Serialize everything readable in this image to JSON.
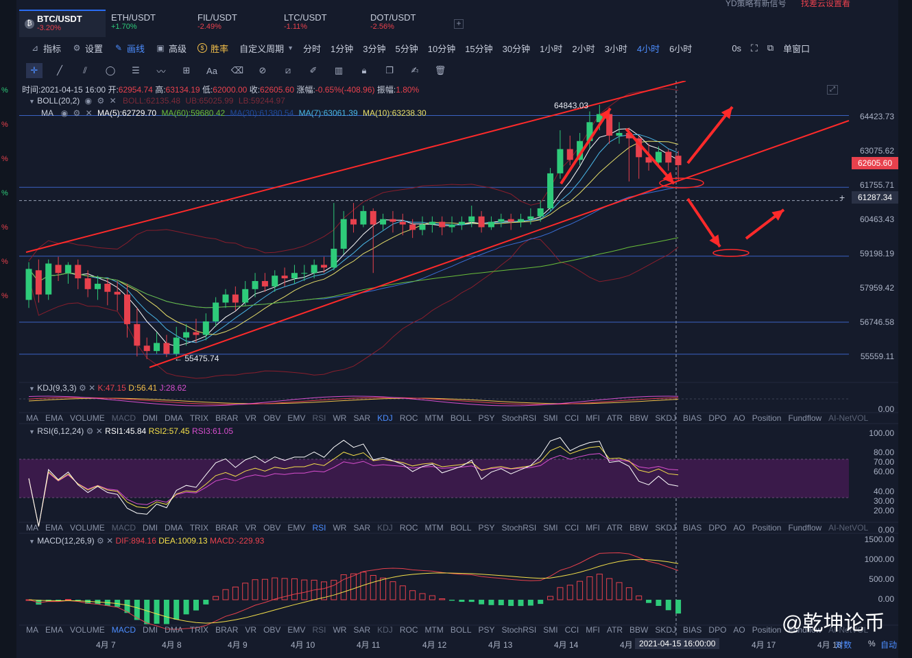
{
  "top_notice": {
    "left": "YD策略有新信号",
    "right": "找差云设置看"
  },
  "tabs": [
    {
      "symbol": "BTC/USDT",
      "change": "-3.20%",
      "dir": "neg",
      "icon": "btc-coin-icon"
    },
    {
      "symbol": "ETH/USDT",
      "change": "+1.70%",
      "dir": "pos"
    },
    {
      "symbol": "FIL/USDT",
      "change": "-2.49%",
      "dir": "neg"
    },
    {
      "symbol": "LTC/USDT",
      "change": "-1.11%",
      "dir": "neg"
    },
    {
      "symbol": "DOT/USDT",
      "change": "-2.56%",
      "dir": "neg"
    }
  ],
  "tab_add": "+",
  "toolbar": {
    "indicators": "指标",
    "settings": "设置",
    "draw": "画线",
    "advanced": "高级",
    "winrate": "胜率",
    "custom_period": "自定义周期",
    "periods": [
      "分时",
      "1分钟",
      "3分钟",
      "5分钟",
      "10分钟",
      "15分钟",
      "30分钟",
      "1小时",
      "2小时",
      "3小时",
      "4小时",
      "6小时"
    ],
    "active_period": "4小时",
    "countdown": "0s",
    "single_window": "单窗口"
  },
  "drawing_tools": [
    "crosshair-icon",
    "line-icon",
    "ray-icon",
    "circle-icon",
    "parallel-icon",
    "wave-icon",
    "rect-icon",
    "text-icon",
    "eraser-icon",
    "magnet-icon",
    "ruler-icon",
    "brush-icon",
    "bars-icon",
    "lock-icon",
    "copy-icon",
    "edit-icon",
    "trash-icon"
  ],
  "text_tool_label": "Aa",
  "ohlc_bar": {
    "time_label": "时间:",
    "time": "2021-04-15 16:00",
    "open_label": "开:",
    "open": "62954.74",
    "high_label": "高:",
    "high": "63134.19",
    "low_label": "低:",
    "low": "62000.00",
    "close_label": "收:",
    "close": "62605.60",
    "change_label": "涨幅:",
    "change": "-0.65%(-408.96)",
    "amp_label": "振幅:",
    "amp": "1.80%"
  },
  "boll_legend": {
    "name": "BOLL(20,2)",
    "boll": "BOLL:62135.48",
    "ub": "UB:65025.99",
    "lb": "LB:59244.97"
  },
  "ma_legend": {
    "name": "MA",
    "ma5": "MA(5):62729.70",
    "ma60": "MA(60):59680.42",
    "ma30": "MA(30):61380.54",
    "ma7": "MA(7):63061.39",
    "ma10": "MA(10):63238.30"
  },
  "price_axis": [
    "64423.73",
    "63075.62",
    "61755.71",
    "60463.43",
    "59198.19",
    "57959.42",
    "56746.58",
    "55559.11"
  ],
  "current_price": "62605.60",
  "cursor_price": "61287.34",
  "cursor_plus": "+",
  "high_marker": "64843.03",
  "low_marker": "55475.74",
  "kdj_legend": {
    "name": "KDJ(9,3,3)",
    "k": "K:47.15",
    "d": "D:56.41",
    "j": "J:28.62",
    "axis": "0.00"
  },
  "indicator_tabs": [
    "MA",
    "EMA",
    "VOLUME",
    "MACD",
    "DMI",
    "DMA",
    "TRIX",
    "BRAR",
    "VR",
    "OBV",
    "EMV",
    "RSI",
    "WR",
    "SAR",
    "KDJ",
    "ROC",
    "MTM",
    "BOLL",
    "PSY",
    "StochRSI",
    "SMI",
    "CCI",
    "MFI",
    "ATR",
    "BBW",
    "SKDJ",
    "BIAS",
    "DPO",
    "AO",
    "Position",
    "Fundflow",
    "AI-NetVOL"
  ],
  "rsi_legend": {
    "name": "RSI(6,12,24)",
    "r1": "RSI1:45.84",
    "r2": "RSI2:57.45",
    "r3": "RSI3:61.05",
    "axis": [
      "100.00",
      "80.00",
      "70.00",
      "60.00",
      "40.00",
      "30.00",
      "20.00",
      "0.00"
    ]
  },
  "macd_legend": {
    "name": "MACD(12,26,9)",
    "dif": "DIF:894.16",
    "dea": "DEA:1009.13",
    "macd": "MACD:-229.93",
    "axis": [
      "1500.00",
      "1000.00",
      "500.00",
      "0.00"
    ]
  },
  "dates": [
    "4月 7",
    "4月 8",
    "4月 9",
    "4月 10",
    "4月 11",
    "4月 12",
    "4月 13",
    "4月 14",
    "4月",
    "4月 17",
    "4月 18"
  ],
  "cursor_date": "2021-04-15 16:00:00",
  "axis_options": {
    "log": "对数",
    "pct": "%",
    "auto": "自动"
  },
  "left_percents": [
    "%",
    "%",
    "%",
    "%",
    "%",
    "%",
    "%"
  ],
  "watermark": "@乾坤论币",
  "colors": {
    "up": "#2ecb7a",
    "down": "#e8414d",
    "accent": "#4c8dff",
    "bg": "#151b2b",
    "annotation": "#ff2a2a"
  }
}
